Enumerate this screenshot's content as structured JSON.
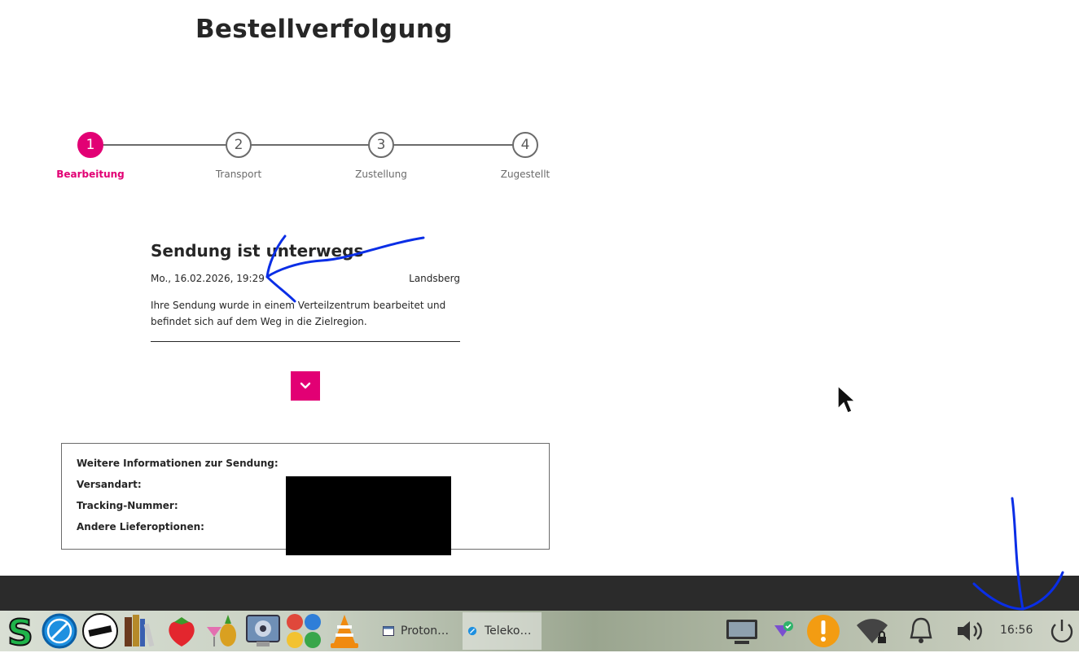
{
  "page": {
    "title": "Bestellverfolgung"
  },
  "stepper": {
    "steps": [
      {
        "number": "1",
        "label": "Bearbeitung",
        "active": true
      },
      {
        "number": "2",
        "label": "Transport",
        "active": false
      },
      {
        "number": "3",
        "label": "Zustellung",
        "active": false
      },
      {
        "number": "4",
        "label": "Zugestellt",
        "active": false
      }
    ],
    "accent_color": "#e20074"
  },
  "shipment": {
    "title": "Sendung ist unterwegs",
    "date": "Mo., 16.02.2026, 19:29",
    "location": "Landsberg",
    "description": "Ihre Sendung wurde in einem Verteilzentrum bearbeitet und befindet sich auf dem Weg in die Zielregion."
  },
  "info": {
    "heading": "Weitere Informationen zur Sendung:",
    "shipping_type_label": "Versandart:",
    "tracking_label": "Tracking-Nummer:",
    "other_options_label": "Andere Lieferoptionen:"
  },
  "taskbar": {
    "launchers": [
      "s-app-icon",
      "browser-compass-icon",
      "disc-app-icon",
      "calibre-books-icon",
      "strawberry-icon",
      "cocktail-pineapple-icon",
      "media-player-icon",
      "box-game-icon",
      "vlc-cone-icon"
    ],
    "windows": [
      {
        "label": "Proton…",
        "active": false
      },
      {
        "label": "Teleko…",
        "active": true
      }
    ],
    "tray": [
      "display-icon",
      "vpn-shield-icon",
      "update-warning-icon",
      "wifi-lock-icon",
      "notification-bell-icon",
      "volume-icon",
      "power-icon"
    ],
    "clock": "16:56"
  }
}
